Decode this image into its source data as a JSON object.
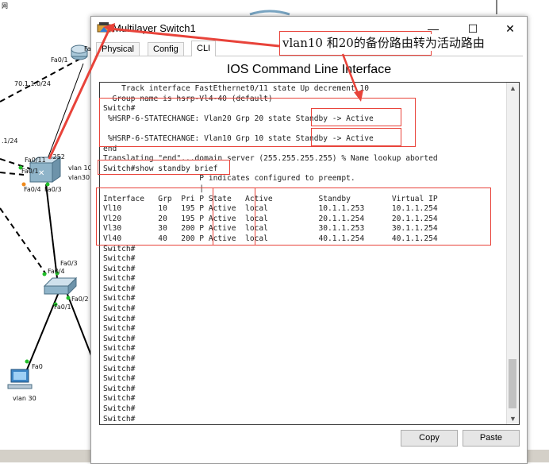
{
  "topology": {
    "labels": {
      "corner": "网",
      "link_70": "70.1.1.0/24",
      "net_1": ".1/24",
      "fa0_1_router": "Fa0/1",
      "fa_cut": "Fa",
      "fa0_11": "Fa0/11",
      "ip_252": ".252",
      "fa0_1_sw": "Fa0/1",
      "fa0_4": "Fa0/4",
      "fa0_3": "Fa0/3",
      "vlan10": "vlan 10",
      "vlan30": "vlan30",
      "fa0_3b": "Fa0/3",
      "fa0_4b": "Fa0/4",
      "fa0_2": "Fa0/2",
      "fa0_1b": "Fa0/1",
      "fa0_pc": "Fa0",
      "pc_vlan": "vlan 30"
    }
  },
  "window": {
    "title": "Multilayer Switch1",
    "controls": {
      "minimize": "—",
      "maximize": "☐",
      "close": "✕"
    },
    "tabs": [
      "Physical",
      "Config",
      "CLI"
    ],
    "active_tab": "CLI",
    "panel_title": "IOS Command Line Interface",
    "cli_lines": [
      "    Track interface FastEthernet0/11 state Up decrement 10",
      "  Group name is hsrp-Vl4-40 (default)",
      "Switch#",
      " %HSRP-6-STATECHANGE: Vlan20 Grp 20 state Standby -> Active",
      "",
      " %HSRP-6-STATECHANGE: Vlan10 Grp 10 state Standby -> Active",
      "end",
      "Translating \"end\"...domain server (255.255.255.255) % Name lookup aborted",
      "Switch#show standby brief",
      "                     P indicates configured to preempt.",
      "                     |",
      "Interface   Grp  Pri P State   Active          Standby         Virtual IP",
      "Vl10        10   195 P Active  local           10.1.1.253      10.1.1.254",
      "Vl20        20   195 P Active  local           20.1.1.254      20.1.1.254",
      "Vl30        30   200 P Active  local           30.1.1.253      30.1.1.254",
      "Vl40        40   200 P Active  local           40.1.1.254      40.1.1.254",
      "Switch#",
      "Switch#",
      "Switch#",
      "Switch#",
      "Switch#",
      "Switch#",
      "Switch#",
      "Switch#",
      "Switch#",
      "Switch#",
      "Switch#",
      "Switch#",
      "Switch#",
      "Switch#",
      "Switch#",
      "Switch#",
      "Switch#",
      "Switch#"
    ],
    "buttons": {
      "copy": "Copy",
      "paste": "Paste"
    }
  },
  "annotation": {
    "text": "vlan10  和20的备份路由转为活动路由",
    "color": "#e8433a"
  },
  "colors": {
    "highlight_red": "#e8433a",
    "link_green": "#22c02a",
    "link_orange": "#f08a1c"
  }
}
